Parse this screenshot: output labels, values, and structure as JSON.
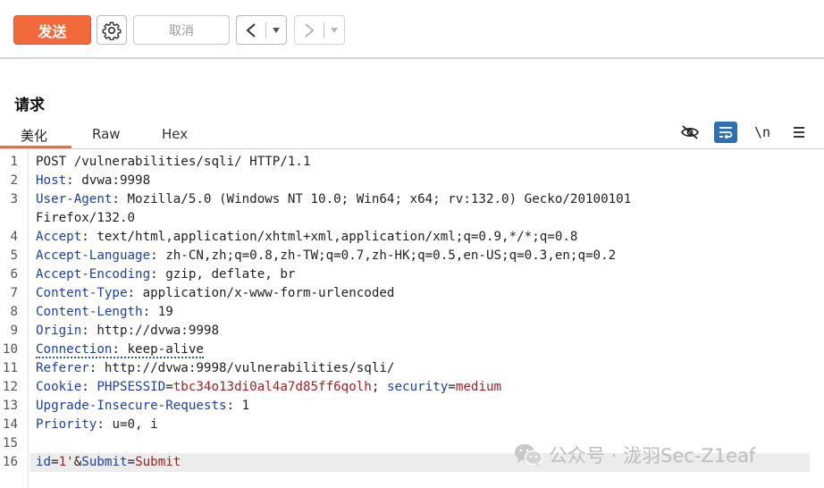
{
  "toolbar": {
    "send_label": "发送",
    "cancel_label": "取消",
    "prev_glyph": "<",
    "next_glyph": ">",
    "dropdown_glyph": "▾"
  },
  "request": {
    "title": "请求",
    "tabs": [
      {
        "label": "美化",
        "active": true
      },
      {
        "label": "Raw",
        "active": false
      },
      {
        "label": "Hex",
        "active": false
      }
    ],
    "tools": [
      "hide-eye-icon",
      "wrap-lines-icon",
      "newline-icon",
      "menu-icon"
    ],
    "newline_label": "\\n"
  },
  "lines": [
    {
      "n": "1",
      "text": "POST /vulnerabilities/sqli/ HTTP/1.1"
    },
    {
      "n": "2",
      "name": "Host",
      "value": "dvwa:9998"
    },
    {
      "n": "3",
      "name": "User-Agent",
      "value": "Mozilla/5.0 (Windows NT 10.0; Win64; x64; rv:132.0) Gecko/20100101"
    },
    {
      "n": "",
      "text": "Firefox/132.0"
    },
    {
      "n": "4",
      "name": "Accept",
      "value": "text/html,application/xhtml+xml,application/xml;q=0.9,*/*;q=0.8"
    },
    {
      "n": "5",
      "name": "Accept-Language",
      "value": "zh-CN,zh;q=0.8,zh-TW;q=0.7,zh-HK;q=0.5,en-US;q=0.3,en;q=0.2"
    },
    {
      "n": "6",
      "name": "Accept-Encoding",
      "value": "gzip, deflate, br"
    },
    {
      "n": "7",
      "name": "Content-Type",
      "value": "application/x-www-form-urlencoded"
    },
    {
      "n": "8",
      "name": "Content-Length",
      "value": "19"
    },
    {
      "n": "9",
      "name": "Origin",
      "value": "http://dvwa:9998"
    },
    {
      "n": "10",
      "name": "Connection",
      "value": "keep-alive",
      "underline": true
    },
    {
      "n": "11",
      "name": "Referer",
      "value": "http://dvwa:9998/vulnerabilities/sqli/"
    },
    {
      "n": "12",
      "name": "Cookie",
      "cookie": [
        {
          "k": "PHPSESSID",
          "v": "tbc34o13di0al4a7d85ff6qolh",
          "sep": "; "
        },
        {
          "k": "security",
          "v": "medium",
          "sep": ""
        }
      ]
    },
    {
      "n": "13",
      "name": "Upgrade-Insecure-Requests",
      "value": "1"
    },
    {
      "n": "14",
      "name": "Priority",
      "value": "u=0, i"
    },
    {
      "n": "15",
      "text": ""
    },
    {
      "n": "16",
      "body": [
        {
          "k": "id",
          "v": "1'",
          "sep": "&"
        },
        {
          "k": "Submit",
          "v": "Submit",
          "sep": ""
        }
      ],
      "highlight": true
    }
  ],
  "watermark": "公众号 · 泷羽Sec-Z1eaf"
}
